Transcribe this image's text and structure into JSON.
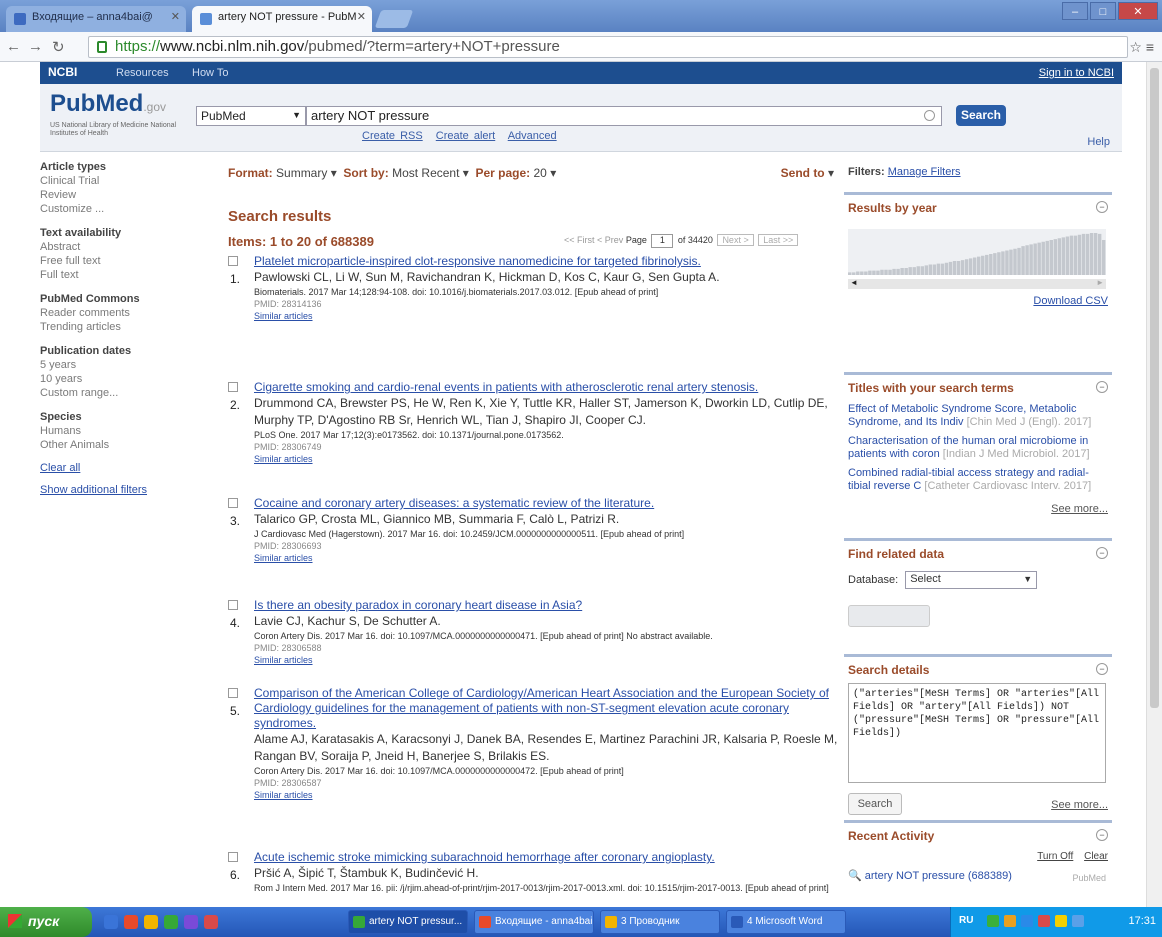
{
  "browser": {
    "tabs": [
      {
        "label": "Входящие – anna4bai@"
      },
      {
        "label": "artery NOT pressure - PubM"
      }
    ],
    "url_protocol": "https://",
    "url_host": "www.ncbi.nlm.nih.gov",
    "url_path": "/pubmed/?term=artery+NOT+pressure"
  },
  "ncbi": {
    "logo": "NCBI",
    "resources": "Resources",
    "howto": "How To",
    "signin": "Sign in to NCBI"
  },
  "pubmed": {
    "logo": "PubMed",
    "logo_suffix": ".gov",
    "subtitle": "US National Library of Medicine National Institutes of Health",
    "db_select": "PubMed",
    "query": "artery NOT pressure",
    "search_btn": "Search",
    "sublinks": [
      "Create RSS",
      "Create alert",
      "Advanced"
    ],
    "help": "Help"
  },
  "sidebar": {
    "groups": [
      {
        "title": "Article types",
        "items": [
          "Clinical Trial",
          "Review",
          "Customize ..."
        ]
      },
      {
        "title": "Text availability",
        "items": [
          "Abstract",
          "Free full text",
          "Full text"
        ]
      },
      {
        "title": "PubMed Commons",
        "items": [
          "Reader comments",
          "Trending articles"
        ]
      },
      {
        "title": "Publication dates",
        "items": [
          "5 years",
          "10 years",
          "Custom range..."
        ]
      },
      {
        "title": "Species",
        "items": [
          "Humans",
          "Other Animals"
        ]
      }
    ],
    "clear_all": "Clear all",
    "show_filters": "Show additional filters"
  },
  "main": {
    "format_label": "Format:",
    "format_value": "Summary",
    "sortby_label": "Sort by:",
    "sortby_value": "Most Recent",
    "perpage_label": "Per page:",
    "perpage_value": "20",
    "sendto": "Send to",
    "results_title": "Search results",
    "items": "Items: 1 to 20 of 688389",
    "pager_first": "<< First",
    "pager_prev": "< Prev",
    "pager_page_label": "Page",
    "pager_page": "1",
    "pager_of": "of 34420",
    "pager_next": "Next >",
    "pager_last": "Last >>"
  },
  "results": [
    {
      "num": "1.",
      "title": "Platelet microparticle-inspired clot-responsive nanomedicine for targeted fibrinolysis.",
      "authors": "Pawlowski CL, Li W, Sun M, Ravichandran K, Hickman D, Kos C, Kaur G, Sen Gupta A.",
      "cite": "Biomaterials. 2017 Mar 14;128:94-108. doi: 10.1016/j.biomaterials.2017.03.012. [Epub ahead of print]",
      "pmid": "PMID: 28314136",
      "similar": "Similar articles"
    },
    {
      "num": "2.",
      "title": "Cigarette smoking and cardio-renal events in patients with atherosclerotic renal artery stenosis.",
      "authors": "Drummond CA, Brewster PS, He W, Ren K, Xie Y, Tuttle KR, Haller ST, Jamerson K, Dworkin LD, Cutlip DE, Murphy TP, D'Agostino RB Sr, Henrich WL, Tian J, Shapiro JI, Cooper CJ.",
      "cite": "PLoS One. 2017 Mar 17;12(3):e0173562. doi: 10.1371/journal.pone.0173562.",
      "pmid": "PMID: 28306749",
      "similar": "Similar articles"
    },
    {
      "num": "3.",
      "title": "Cocaine and coronary artery diseases: a systematic review of the literature.",
      "authors": "Talarico GP, Crosta ML, Giannico MB, Summaria F, Calò L, Patrizi R.",
      "cite": "J Cardiovasc Med (Hagerstown). 2017 Mar 16. doi: 10.2459/JCM.0000000000000511. [Epub ahead of print]",
      "pmid": "PMID: 28306693",
      "similar": "Similar articles"
    },
    {
      "num": "4.",
      "title": "Is there an obesity paradox in coronary heart disease in Asia?",
      "authors": "Lavie CJ, Kachur S, De Schutter A.",
      "cite": "Coron Artery Dis. 2017 Mar 16. doi: 10.1097/MCA.0000000000000471. [Epub ahead of print] No abstract available.",
      "pmid": "PMID: 28306588",
      "similar": "Similar articles"
    },
    {
      "num": "5.",
      "title": "Comparison of the American College of Cardiology/American Heart Association and the European Society of Cardiology guidelines for the management of patients with non-ST-segment elevation acute coronary syndromes.",
      "authors": "Alame AJ, Karatasakis A, Karacsonyi J, Danek BA, Resendes E, Martinez Parachini JR, Kalsaria P, Roesle M, Rangan BV, Soraija P, Jneid H, Banerjee S, Brilakis ES.",
      "cite": "Coron Artery Dis. 2017 Mar 16. doi: 10.1097/MCA.0000000000000472. [Epub ahead of print]",
      "pmid": "PMID: 28306587",
      "similar": "Similar articles"
    },
    {
      "num": "6.",
      "title": "Acute ischemic stroke mimicking subarachnoid hemorrhage after coronary angioplasty.",
      "authors": "Pršić A, Šipić T, Štambuk K, Budinčević H.",
      "cite": "Rom J Intern Med. 2017 Mar 16. pii: /j/rjim.ahead-of-print/rjim-2017-0013/rjim-2017-0013.xml. doi: 10.1515/rjim-2017-0013. [Epub ahead of print]",
      "pmid": "",
      "similar": ""
    }
  ],
  "right": {
    "filters_label": "Filters:",
    "manage_filters": "Manage Filters",
    "results_by_year": "Results by year",
    "download_csv": "Download CSV",
    "titles_header": "Titles with your search terms",
    "titles": [
      {
        "title": "Effect of Metabolic Syndrome Score, Metabolic Syndrome, and Its Indiv",
        "meta": "[Chin Med J (Engl). 2017]"
      },
      {
        "title": "Characterisation of the human oral microbiome in patients with coron",
        "meta": "[Indian J Med Microbiol. 2017]"
      },
      {
        "title": "Combined radial-tibial access strategy and radial-tibial reverse C",
        "meta": "[Catheter Cardiovasc Interv. 2017]"
      }
    ],
    "see_more": "See more...",
    "find_related": "Find related data",
    "database_label": "Database:",
    "database_value": "Select",
    "search_details": "Search details",
    "details_text": "(\"arteries\"[MeSH Terms] OR \"arteries\"[All Fields] OR \"artery\"[All Fields]) NOT (\"pressure\"[MeSH Terms] OR \"pressure\"[All Fields])",
    "details_search": "Search",
    "details_see_more": "See more...",
    "recent_activity": "Recent Activity",
    "turn_off": "Turn Off",
    "clear": "Clear",
    "recent_item": "artery NOT pressure (688389)",
    "recent_db": "PubMed"
  },
  "taskbar": {
    "start": "пуск",
    "tasks": [
      {
        "label": "artery NOT pressur..."
      },
      {
        "label": "Входящие - anna4bai..."
      },
      {
        "label": "3 Проводник"
      },
      {
        "label": "4 Microsoft Word"
      }
    ],
    "lang": "RU",
    "clock": "17:31"
  },
  "year_chart": {
    "values": [
      3,
      3,
      4,
      4,
      4,
      5,
      5,
      5,
      6,
      6,
      6,
      7,
      7,
      8,
      8,
      9,
      9,
      10,
      10,
      11,
      12,
      12,
      13,
      13,
      14,
      15,
      16,
      16,
      17,
      18,
      19,
      20,
      21,
      22,
      23,
      24,
      25,
      26,
      27,
      28,
      29,
      30,
      31,
      33,
      34,
      35,
      36,
      37,
      38,
      39,
      40,
      41,
      42,
      43,
      44,
      45,
      45,
      46,
      47,
      47,
      48,
      48,
      47,
      40
    ]
  },
  "colors": {
    "ncbi_blue": "#1d4e8f",
    "accent_brown": "#9a4b2a",
    "link_blue": "#2a4fa8",
    "search_btn": "#2a5ea8"
  }
}
